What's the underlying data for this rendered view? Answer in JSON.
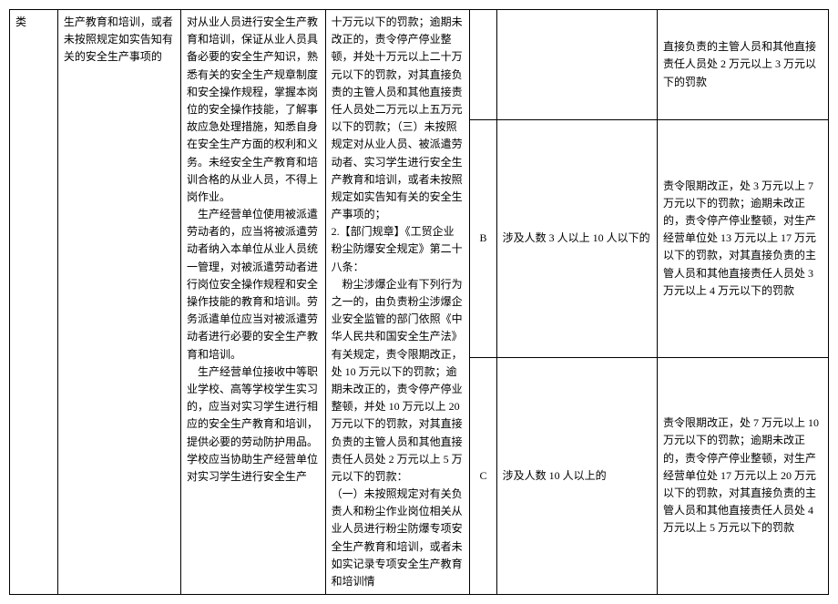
{
  "table": {
    "col1_row1": "类",
    "col2_row1": "生产教育和培训，或者未按照规定如实告知有关的安全生产事项的",
    "col3_merged": "对从业人员进行安全生产教育和培训，保证从业人员具备必要的安全生产知识，熟悉有关的安全生产规章制度和安全操作规程，掌握本岗位的安全操作技能，了解事故应急处理措施，知悉自身在安全生产方面的权利和义务。未经安全生产教育和培训合格的从业人员，不得上岗作业。\n    生产经营单位使用被派遣劳动者的，应当将被派遣劳动者纳入本单位从业人员统一管理，对被派遣劳动者进行岗位安全操作规程和安全操作技能的教育和培训。劳务派遣单位应当对被派遣劳动者进行必要的安全生产教育和培训。\n    生产经营单位接收中等职业学校、高等学校学生实习的，应当对实习学生进行相应的安全生产教育和培训，提供必要的劳动防护用品。学校应当协助生产经营单位对实习学生进行安全生产",
    "col4_merged": "十万元以下的罚款；逾期未改正的，责令停产停业整顿，并处十万元以上二十万元以下的罚款，对其直接负责的主管人员和其他直接责任人员处二万元以上五万元以下的罚款；（三）未按照规定对从业人员、被派遣劳动者、实习学生进行安全生产教育和培训，或者未按照规定如实告知有关的安全生产事项的；\n2.【部门规章】《工贸企业粉尘防爆安全规定》第二十八条：\n    粉尘涉爆企业有下列行为之一的，由负责粉尘涉爆企业安全监管的部门依照《中华人民共和国安全生产法》有关规定，责令限期改正，处 10 万元以下的罚款；逾期未改正的，责令停产停业整顿，并处 10 万元以上 20 万元以下的罚款，对其直接负责的主管人员和其他直接责任人员处 2 万元以上 5 万元以下的罚款：\n（一）未按照规定对有关负责人和粉尘作业岗位相关从业人员进行粉尘防爆专项安全生产教育和培训，或者未如实记录专项安全生产教育和培训情",
    "row1": {
      "c5": "",
      "c6": "",
      "c7": "直接负责的主管人员和其他直接责任人员处 2 万元以上 3 万元以下的罚款"
    },
    "row2": {
      "c5": "B",
      "c6": "涉及人数 3 人以上 10 人以下的",
      "c7": "责令限期改正，处 3 万元以上 7 万元以下的罚款；逾期未改正的，责令停产停业整顿，对生产经营单位处 13 万元以上 17 万元以下的罚款，对其直接负责的主管人员和其他直接责任人员处 3 万元以上 4 万元以下的罚款"
    },
    "row3": {
      "c5": "C",
      "c6": "涉及人数 10 人以上的",
      "c7": "责令限期改正，处 7 万元以上 10 万元以下的罚款；逾期未改正的，责令停产停业整顿，对生产经营单位处 17 万元以上 20 万元以下的罚款，对其直接负责的主管人员和其他直接责任人员处 4 万元以上 5 万元以下的罚款"
    }
  }
}
